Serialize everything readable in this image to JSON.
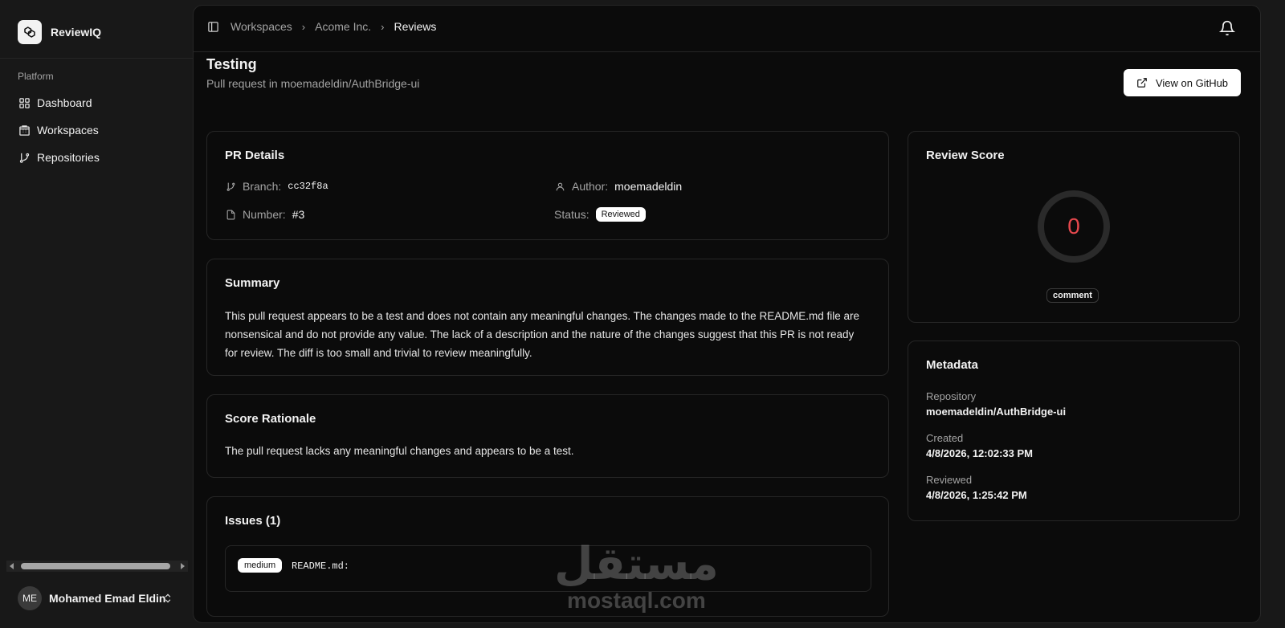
{
  "sidebar": {
    "brand": "ReviewIQ",
    "section_label": "Platform",
    "items": [
      {
        "label": "Dashboard",
        "icon": "grid-icon"
      },
      {
        "label": "Workspaces",
        "icon": "building-icon"
      },
      {
        "label": "Repositories",
        "icon": "git-branch-icon"
      }
    ],
    "user": {
      "initials": "ME",
      "name": "Mohamed Emad Eldin"
    }
  },
  "breadcrumb": [
    "Workspaces",
    "Acome Inc.",
    "Reviews"
  ],
  "page": {
    "title": "Testing",
    "subtitle": "Pull request in moemadeldin/AuthBridge-ui",
    "github_button": "View on GitHub"
  },
  "pr_details": {
    "title": "PR Details",
    "branch_label": "Branch:",
    "branch_value": "cc32f8a",
    "number_label": "Number:",
    "number_value": "#3",
    "author_label": "Author:",
    "author_value": "moemadeldin",
    "status_label": "Status:",
    "status_value": "Reviewed"
  },
  "summary": {
    "title": "Summary",
    "text": "This pull request appears to be a test and does not contain any meaningful changes. The changes made to the README.md file are nonsensical and do not provide any value. The lack of a description and the nature of the changes suggest that this PR is not ready for review. The diff is too small and trivial to review meaningfully."
  },
  "rationale": {
    "title": "Score Rationale",
    "text": "The pull request lacks any meaningful changes and appears to be a test."
  },
  "issues": {
    "title": "Issues (1)",
    "items": [
      {
        "severity": "medium",
        "file": "README.md:"
      }
    ]
  },
  "review_score": {
    "title": "Review Score",
    "score": "0",
    "badge": "comment"
  },
  "metadata": {
    "title": "Metadata",
    "repository_label": "Repository",
    "repository_value": "moemadeldin/AuthBridge-ui",
    "created_label": "Created",
    "created_value": "4/8/2026, 12:02:33 PM",
    "reviewed_label": "Reviewed",
    "reviewed_value": "4/8/2026, 1:25:42 PM"
  },
  "watermark": {
    "arabic": "مستقل",
    "latin": "mostaql.com"
  },
  "colors": {
    "score": "#e5484d",
    "background": "#0b0b0b",
    "sidebar": "#181818",
    "border": "#262626"
  }
}
